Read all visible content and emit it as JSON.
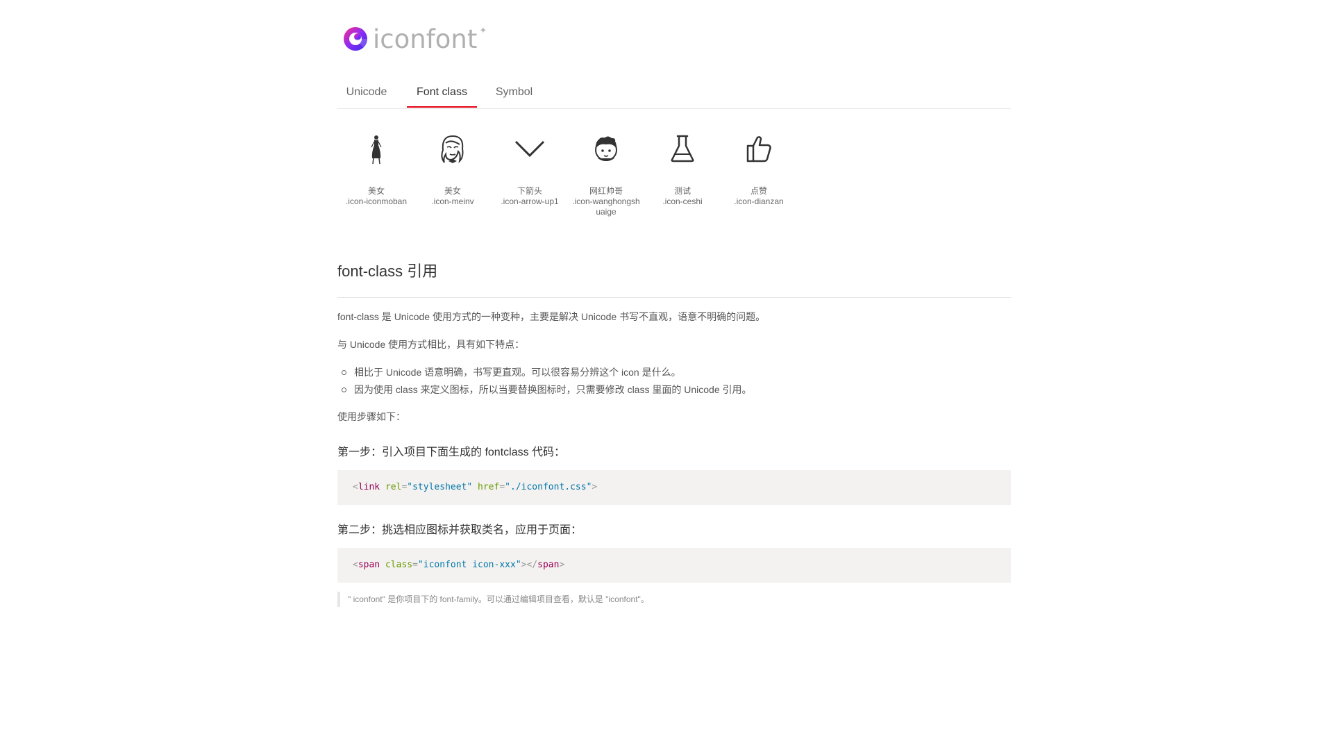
{
  "logo": {
    "text": "iconfont",
    "star": "✦",
    "icon_name": "iconfont-logo-icon"
  },
  "tabs": [
    {
      "label": "Unicode",
      "active": false
    },
    {
      "label": "Font class",
      "active": true
    },
    {
      "label": "Symbol",
      "active": false
    }
  ],
  "accent_color": "#e50012",
  "icons": [
    {
      "name": "美女",
      "code": ".icon-iconmoban",
      "icon": "woman-dress-icon"
    },
    {
      "name": "美女",
      "code": ".icon-meinv",
      "icon": "woman-portrait-icon"
    },
    {
      "name": "下箭头",
      "code": ".icon-arrow-up1",
      "icon": "chevron-down-icon"
    },
    {
      "name": "网红帅哥",
      "code": ".icon-wanghongshuaige",
      "icon": "handsome-man-icon"
    },
    {
      "name": "测试",
      "code": ".icon-ceshi",
      "icon": "flask-icon"
    },
    {
      "name": "点赞",
      "code": ".icon-dianzan",
      "icon": "thumbs-up-icon"
    }
  ],
  "section": {
    "title": "font-class 引用",
    "intro": "font-class 是 Unicode 使用方式的一种变种，主要是解决 Unicode 书写不直观，语意不明确的问题。",
    "compare": "与 Unicode 使用方式相比，具有如下特点：",
    "features": [
      "相比于 Unicode 语意明确，书写更直观。可以很容易分辨这个 icon 是什么。",
      "因为使用 class 来定义图标，所以当要替换图标时，只需要修改 class 里面的 Unicode 引用。"
    ],
    "steps_intro": "使用步骤如下：",
    "step1": "第一步：引入项目下面生成的 fontclass 代码：",
    "code1": {
      "open": "<",
      "tag": "link",
      "attr1": "rel",
      "eq1": "=",
      "val1": "\"stylesheet\"",
      "attr2": "href",
      "eq2": "=",
      "val2": "\"./iconfont.css\"",
      "close": ">"
    },
    "step2": "第二步：挑选相应图标并获取类名，应用于页面：",
    "code2": {
      "open": "<",
      "tag": "span",
      "attr1": "class",
      "eq1": "=",
      "val1": "\"iconfont icon-xxx\"",
      "close": "></",
      "tag_end": "span",
      "close_end": ">"
    },
    "note": "\" iconfont\" 是你项目下的 font-family。可以通过编辑项目查看，默认是 \"iconfont\"。"
  }
}
